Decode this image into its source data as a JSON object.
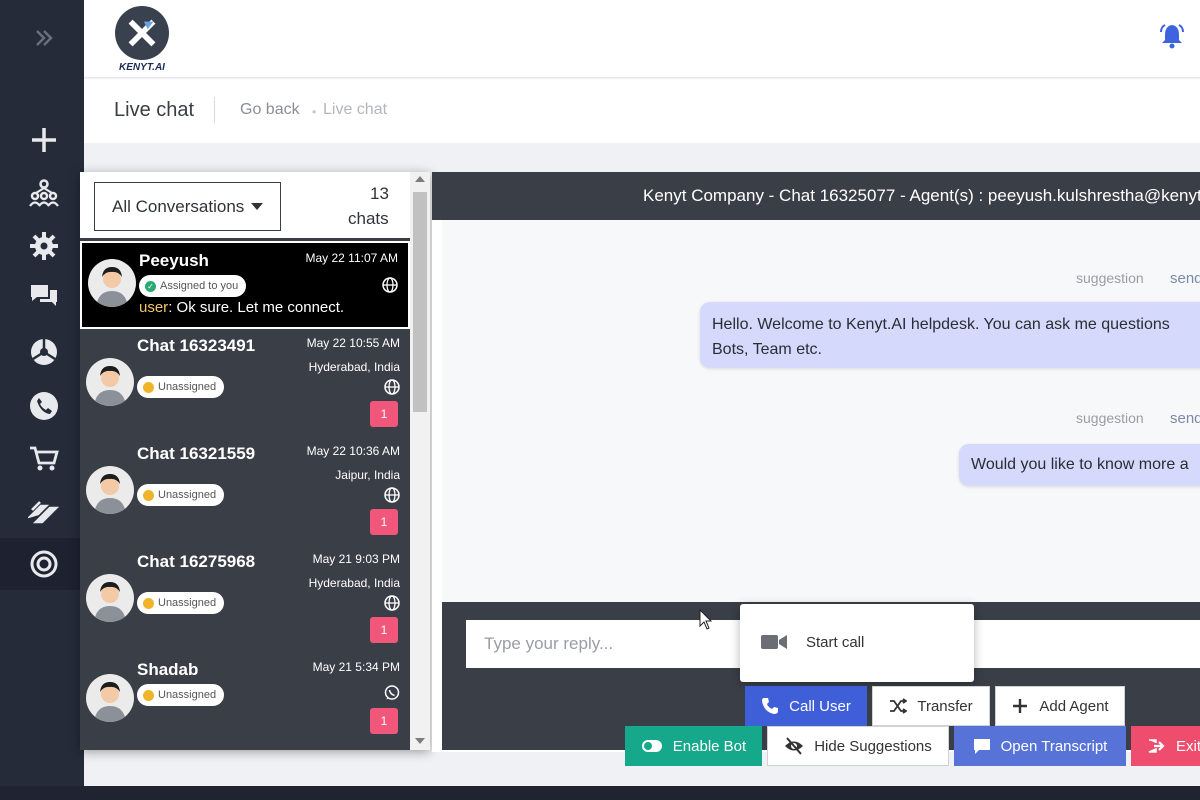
{
  "app": {
    "logo_text": "KENYT.AI",
    "page_title": "Live chat",
    "breadcrumb": {
      "back": "Go back",
      "separator": "•",
      "current": "Live chat"
    }
  },
  "sidebar": {
    "items": [
      {
        "icon": "expand-icon"
      },
      {
        "icon": "plus-icon"
      },
      {
        "icon": "network-icon"
      },
      {
        "icon": "gear-icon"
      },
      {
        "icon": "chat-bubbles-icon"
      },
      {
        "icon": "pie-chart-icon"
      },
      {
        "icon": "phone-icon"
      },
      {
        "icon": "cart-icon"
      },
      {
        "icon": "handshake-icon"
      },
      {
        "icon": "support-ring-icon"
      }
    ]
  },
  "conversations": {
    "filter_label": "All Conversations",
    "count": "13",
    "count_label": "chats",
    "items": [
      {
        "name": "Peeyush",
        "time": "May 22 11:07 AM",
        "status": "Assigned to you",
        "sender": "user",
        "message": ": Ok sure. Let me connect.",
        "channel": "globe-icon"
      },
      {
        "name": "Chat 16323491",
        "time": "May 22 10:55 AM",
        "location": "Hyderabad, India",
        "status": "Unassigned",
        "unread": "1",
        "channel": "globe-icon"
      },
      {
        "name": "Chat 16321559",
        "time": "May 22 10:36 AM",
        "location": "Jaipur, India",
        "status": "Unassigned",
        "unread": "1",
        "channel": "globe-icon"
      },
      {
        "name": "Chat 16275968",
        "time": "May 21 9:03 PM",
        "location": "Hyderabad, India",
        "status": "Unassigned",
        "unread": "1",
        "channel": "globe-icon"
      },
      {
        "name": "Shadab",
        "time": "May 21 5:34 PM",
        "status": "Unassigned",
        "unread": "1",
        "channel": "whatsapp-icon"
      }
    ]
  },
  "chat": {
    "header": "Kenyt Company - Chat 16325077 - Agent(s) : peeyush.kulshrestha@kenyt",
    "messages": [
      {
        "suggestion_label": "suggestion",
        "send_label": "send",
        "text_line1": "Hello. Welcome to Kenyt.AI helpdesk. You can ask me questions",
        "text_line2": "Bots, Team etc."
      },
      {
        "suggestion_label": "suggestion",
        "send_label": "send",
        "text_line1": "Would you like to know more a"
      }
    ],
    "reply_placeholder": "Type your reply...",
    "popup_item": "Start call",
    "actions": {
      "call_user": "Call User",
      "transfer": "Transfer",
      "add_agent": "Add Agent",
      "enable_bot": "Enable Bot",
      "hide_suggestions": "Hide Suggestions",
      "open_transcript": "Open Transcript",
      "exit": "Exit"
    }
  },
  "colors": {
    "sidebar_bg": "#262b3a",
    "panel_dark": "#3a3e47",
    "bubble": "#d5d9fb",
    "call_btn": "#3f5fd9",
    "bot_btn": "#15a88a",
    "transcript_btn": "#5873d8",
    "exit_btn": "#ef4d6d",
    "unread_badge": "#f1577b",
    "bell": "#3d63e0"
  }
}
